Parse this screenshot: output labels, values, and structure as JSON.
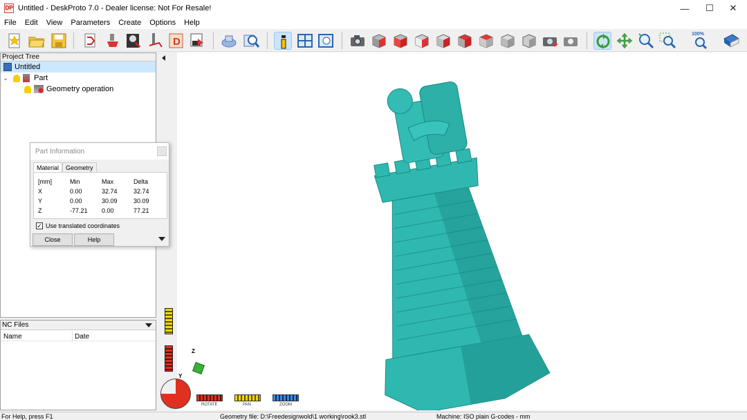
{
  "window": {
    "title": "Untitled - DeskProto 7.0 - Dealer license: Not For Resale!",
    "icon_text": "DP",
    "controls": {
      "minimize": "—",
      "maximize": "☐",
      "close": "✕"
    }
  },
  "menu": [
    "File",
    "Edit",
    "View",
    "Parameters",
    "Create",
    "Options",
    "Help"
  ],
  "toolbar": {
    "zoom_label": "100%"
  },
  "project_tree": {
    "header": "Project Tree",
    "root": "Untitled",
    "part": "Part",
    "operation": "Geometry operation"
  },
  "nc_files": {
    "header": "NC Files",
    "columns": [
      "Name",
      "Date"
    ]
  },
  "part_info": {
    "title": "Part Information",
    "tabs": [
      "Material",
      "Geometry"
    ],
    "table": {
      "headers": [
        "[mm]",
        "Min",
        "Max",
        "Delta"
      ],
      "rows": [
        [
          "X",
          "0.00",
          "32.74",
          "32.74"
        ],
        [
          "Y",
          "0.00",
          "30.09",
          "30.09"
        ],
        [
          "Z",
          "-77.21",
          "0.00",
          "77.21"
        ]
      ]
    },
    "checkbox_label": "Use translated coordinates",
    "checkbox_checked": true,
    "close_label": "Close",
    "help_label": "Help"
  },
  "view_controls": {
    "rotate": "ROTATE",
    "pan": "PAN",
    "zoom": "ZOOM",
    "axis_z": "Z",
    "axis_y": "Y"
  },
  "status": {
    "help": "For Help, press F1",
    "geometry": "Geometry file: D:\\Freedesignwold\\1 working\\rook3.stl",
    "machine": "Machine: ISO plain G-codes - mm"
  }
}
